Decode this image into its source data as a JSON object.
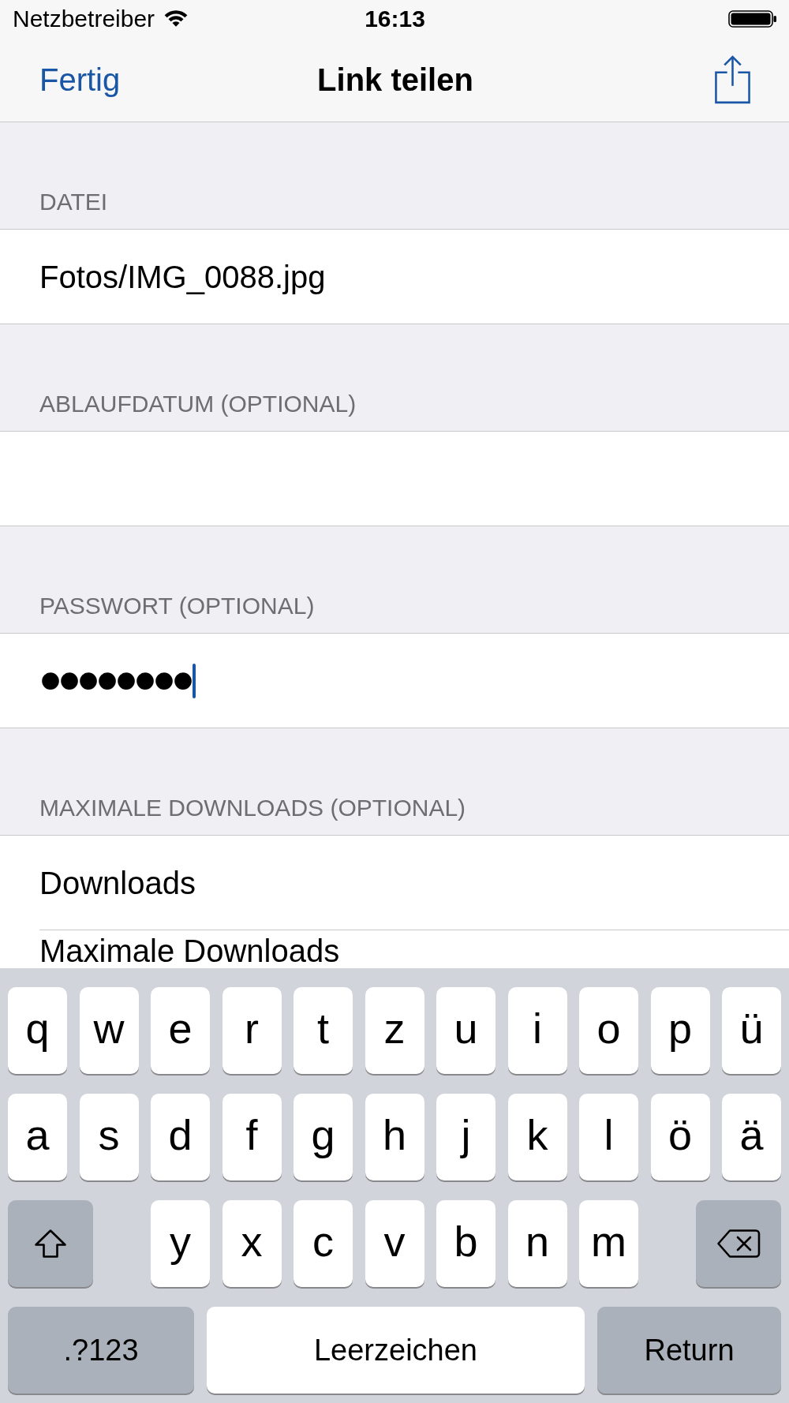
{
  "status_bar": {
    "carrier": "Netzbetreiber",
    "time": "16:13"
  },
  "nav_bar": {
    "done_button": "Fertig",
    "title": "Link teilen"
  },
  "sections": [
    {
      "header": "DATEI",
      "rows": [
        {
          "kind": "text",
          "text": "Fotos/IMG_0088.jpg"
        }
      ]
    },
    {
      "header": "ABLAUFDATUM (OPTIONAL)",
      "rows": [
        {
          "kind": "field",
          "focused": false
        }
      ]
    },
    {
      "header": "PASSWORT (OPTIONAL)",
      "rows": [
        {
          "kind": "password",
          "value": "••••••••",
          "focused": true
        }
      ]
    },
    {
      "header": "MAXIMALE DOWNLOADS (OPTIONAL)",
      "rows": [
        {
          "kind": "text",
          "text": "Downloads"
        },
        {
          "kind": "text",
          "text": "Maximale Downloads"
        }
      ]
    }
  ],
  "keyboard": {
    "letter_rows": [
      [
        "q",
        "w",
        "e",
        "r",
        "t",
        "z",
        "u",
        "i",
        "o",
        "p",
        "ü"
      ],
      [
        "a",
        "s",
        "d",
        "f",
        "g",
        "h",
        "j",
        "k",
        "l",
        "ö",
        "ä"
      ],
      [
        "y",
        "x",
        "c",
        "v",
        "b",
        "n",
        "m"
      ]
    ],
    "numbers_key": ".?123",
    "space_key": "Leerzeichen",
    "return_key": "Return"
  }
}
